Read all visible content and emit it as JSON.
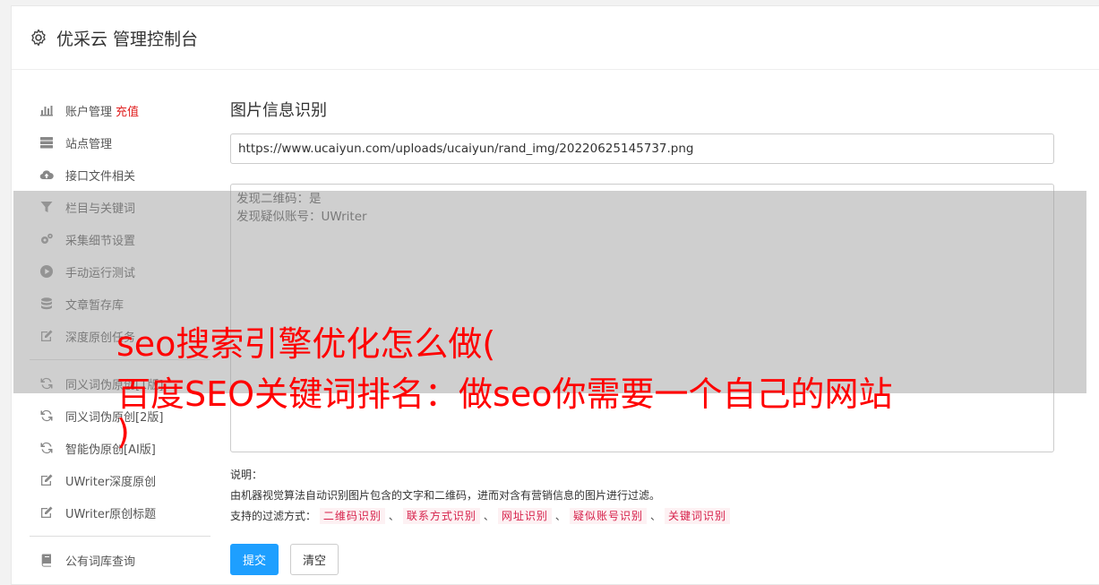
{
  "header": {
    "title": "优采云 管理控制台"
  },
  "sidebar": {
    "items": [
      {
        "label": "账户管理",
        "extra": "充值",
        "icon": "bar-chart-icon"
      },
      {
        "label": "站点管理",
        "icon": "server-icon"
      },
      {
        "label": "接口文件相关",
        "icon": "cloud-upload-icon"
      },
      {
        "label": "栏目与关键词",
        "icon": "filter-icon"
      },
      {
        "label": "采集细节设置",
        "icon": "gears-icon"
      },
      {
        "label": "手动运行测试",
        "icon": "play-circle-icon"
      },
      {
        "label": "文章暂存库",
        "icon": "database-icon"
      },
      {
        "label": "深度原创任务",
        "icon": "edit-icon"
      },
      {
        "label": "同义词伪原创[1版]",
        "icon": "refresh-icon"
      },
      {
        "label": "同义词伪原创[2版]",
        "icon": "refresh-icon"
      },
      {
        "label": "智能伪原创[AI版]",
        "icon": "refresh-icon"
      },
      {
        "label": "UWriter深度原创",
        "icon": "edit-icon"
      },
      {
        "label": "UWriter原创标题",
        "icon": "edit-icon"
      },
      {
        "label": "公有词库查询",
        "icon": "book-icon"
      }
    ]
  },
  "main": {
    "title": "图片信息识别",
    "url_value": "https://www.ucaiyun.com/uploads/ucaiyun/rand_img/20220625145737.png",
    "result_lines": [
      "发现二维码：是",
      "发现疑似账号：UWriter"
    ],
    "desc_title": "说明：",
    "desc_text": "由机器视觉算法自动识别图片包含的文字和二维码，进而对含有营销信息的图片进行过滤。",
    "filter_label": "支持的过滤方式：",
    "filters": [
      "二维码识别",
      "联系方式识别",
      "网址识别",
      "疑似账号识别",
      "关键词识别"
    ],
    "separator": "、",
    "submit_label": "提交",
    "clear_label": "清空"
  },
  "overlay": {
    "line1": "seo搜索引擎优化怎么做(",
    "line2": "百度SEO关键词排名：做seo你需要一个自己的网站",
    "line3": ")"
  }
}
